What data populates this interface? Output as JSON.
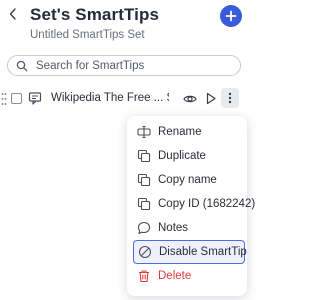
{
  "header": {
    "title": "Set's SmartTips",
    "subtitle": "Untitled SmartTips Set",
    "back_icon": "chevron-left-icon",
    "add_icon": "plus-icon"
  },
  "search": {
    "placeholder": "Search for SmartTips",
    "value": ""
  },
  "list": {
    "items": [
      {
        "label": "Wikipedia The Free ... Smart...",
        "icon": "smarttip-icon",
        "actions": [
          "eye-icon",
          "play-icon",
          "more-vertical-icon"
        ]
      }
    ]
  },
  "context_menu": {
    "items": [
      {
        "label": "Rename",
        "icon": "rename-icon"
      },
      {
        "label": "Duplicate",
        "icon": "duplicate-icon"
      },
      {
        "label": "Copy name",
        "icon": "copy-icon"
      },
      {
        "label": "Copy ID (1682242)",
        "icon": "copy-icon"
      },
      {
        "label": "Notes",
        "icon": "notes-icon"
      },
      {
        "label": "Disable SmartTip",
        "icon": "disable-icon",
        "highlighted": true
      },
      {
        "label": "Delete",
        "icon": "trash-icon",
        "danger": true
      }
    ]
  },
  "colors": {
    "accent": "#3b5bdb",
    "danger": "#e03b3b",
    "text": "#2b2e3a",
    "highlight_border": "#4b6fe0"
  }
}
